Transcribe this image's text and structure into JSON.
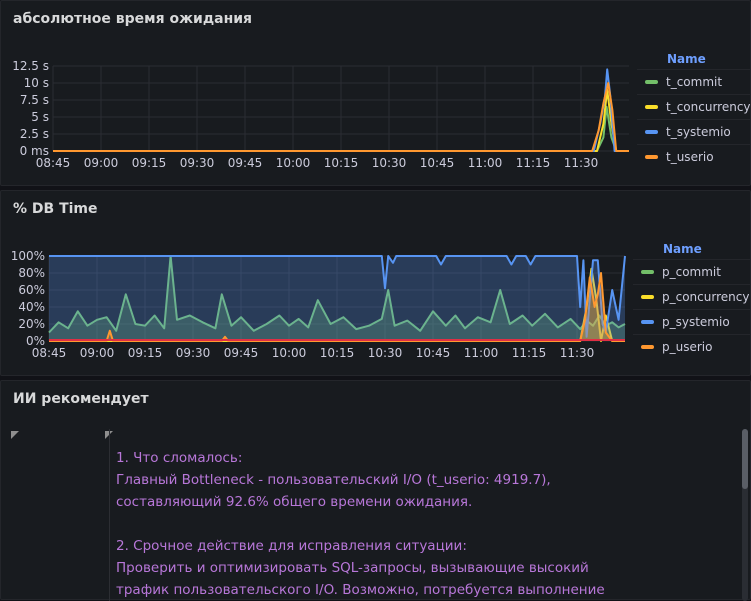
{
  "panels": {
    "wait_time": {
      "title": "абсолютное время ожидания"
    },
    "db_time": {
      "title": "% DB Time"
    },
    "ai": {
      "title": "ИИ рекомендует",
      "text": "1. Что сломалось:\nГлавный Bottleneck - пользовательский I/O (t_userio: 4919.7),\nсоставляющий 92.6% общего времени ожидания.\n\n2. Срочное действие для исправления ситуации:\nПроверить и оптимизировать SQL-запросы, вызывающие высокий\nтрафик пользовательского I/O. Возможно, потребуется выполнение"
    }
  },
  "colors": {
    "commit": "#73bf69",
    "concurrency": "#fade2a",
    "systemio": "#5794f2",
    "userio": "#ff9830",
    "userio_dark": "#e02f44",
    "bg": "#181b1f",
    "legend_header": "#6e9fff",
    "text_purple": "#b877d9"
  },
  "chart_data": [
    {
      "type": "line",
      "x_ticks": [
        "08:45",
        "09:00",
        "09:15",
        "09:30",
        "09:45",
        "10:00",
        "10:15",
        "10:30",
        "10:45",
        "11:00",
        "11:15",
        "11:30"
      ],
      "y_ticks": [
        "0 ms",
        "2.5 s",
        "5 s",
        "7.5 s",
        "10 s",
        "12.5 s"
      ],
      "ylim": [
        0,
        12.5
      ],
      "grid": true,
      "legend_title": "Name",
      "legend_position": "right",
      "series": [
        {
          "name": "t_commit",
          "color": "#73bf69",
          "points": [
            [
              0,
              0
            ],
            [
              170,
              0
            ],
            [
              172,
              2
            ],
            [
              173,
              6.5
            ],
            [
              174.5,
              2
            ],
            [
              176,
              0
            ],
            [
              180,
              0
            ]
          ]
        },
        {
          "name": "t_concurrency",
          "color": "#fade2a",
          "points": [
            [
              0,
              0
            ],
            [
              170,
              0
            ],
            [
              172,
              4
            ],
            [
              173.2,
              9
            ],
            [
              174.5,
              4
            ],
            [
              176,
              0
            ],
            [
              180,
              0
            ]
          ]
        },
        {
          "name": "t_systemio",
          "color": "#5794f2",
          "points": [
            [
              0,
              0
            ],
            [
              169,
              0
            ],
            [
              171,
              4
            ],
            [
              172.5,
              8
            ],
            [
              173.2,
              12
            ],
            [
              174.2,
              8
            ],
            [
              175.5,
              0
            ],
            [
              180,
              0
            ]
          ]
        },
        {
          "name": "t_userio",
          "color": "#ff9830",
          "points": [
            [
              0,
              0
            ],
            [
              168.5,
              0
            ],
            [
              170.5,
              3
            ],
            [
              172,
              7
            ],
            [
              173.5,
              10
            ],
            [
              174.8,
              6
            ],
            [
              176,
              0
            ],
            [
              180,
              0
            ]
          ]
        }
      ]
    },
    {
      "type": "area",
      "x_ticks": [
        "08:45",
        "09:00",
        "09:15",
        "09:30",
        "09:45",
        "10:00",
        "10:15",
        "10:30",
        "10:45",
        "11:00",
        "11:15",
        "11:30"
      ],
      "y_ticks": [
        "0%",
        "20%",
        "40%",
        "60%",
        "80%",
        "100%"
      ],
      "ylim": [
        0,
        100
      ],
      "grid": true,
      "legend_title": "Name",
      "legend_position": "right",
      "series": [
        {
          "name": "p_commit",
          "color": "#73bf69",
          "points": [
            [
              0,
              10
            ],
            [
              3,
              22
            ],
            [
              6,
              15
            ],
            [
              9,
              35
            ],
            [
              12,
              18
            ],
            [
              15,
              25
            ],
            [
              18,
              28
            ],
            [
              21,
              12
            ],
            [
              24,
              55
            ],
            [
              27,
              20
            ],
            [
              30,
              18
            ],
            [
              33,
              30
            ],
            [
              36,
              15
            ],
            [
              38,
              100
            ],
            [
              40,
              25
            ],
            [
              44,
              30
            ],
            [
              48,
              22
            ],
            [
              52,
              15
            ],
            [
              54,
              55
            ],
            [
              57,
              18
            ],
            [
              60,
              28
            ],
            [
              64,
              12
            ],
            [
              68,
              20
            ],
            [
              72,
              30
            ],
            [
              75,
              18
            ],
            [
              78,
              26
            ],
            [
              81,
              16
            ],
            [
              84,
              48
            ],
            [
              88,
              20
            ],
            [
              92,
              28
            ],
            [
              96,
              14
            ],
            [
              100,
              18
            ],
            [
              104,
              26
            ],
            [
              106,
              60
            ],
            [
              108,
              18
            ],
            [
              112,
              24
            ],
            [
              116,
              12
            ],
            [
              120,
              35
            ],
            [
              124,
              18
            ],
            [
              127,
              30
            ],
            [
              130,
              15
            ],
            [
              134,
              28
            ],
            [
              138,
              22
            ],
            [
              141,
              60
            ],
            [
              144,
              20
            ],
            [
              148,
              30
            ],
            [
              151,
              18
            ],
            [
              155,
              32
            ],
            [
              159,
              16
            ],
            [
              163,
              26
            ],
            [
              166,
              14
            ],
            [
              168,
              24
            ],
            [
              170,
              18
            ],
            [
              172,
              30
            ],
            [
              174,
              18
            ],
            [
              176,
              22
            ],
            [
              178,
              16
            ],
            [
              180,
              20
            ]
          ]
        },
        {
          "name": "p_concurrency",
          "color": "#fade2a",
          "points": [
            [
              0,
              0
            ],
            [
              166,
              0
            ],
            [
              168,
              40
            ],
            [
              169.5,
              85
            ],
            [
              171,
              50
            ],
            [
              172.5,
              0
            ],
            [
              174,
              30
            ],
            [
              176,
              0
            ],
            [
              180,
              0
            ]
          ]
        },
        {
          "name": "p_systemio",
          "color": "#5794f2",
          "points": [
            [
              0,
              100
            ],
            [
              104,
              100
            ],
            [
              105,
              62
            ],
            [
              106,
              100
            ],
            [
              107.5,
              92
            ],
            [
              108.5,
              100
            ],
            [
              121,
              100
            ],
            [
              122.5,
              90
            ],
            [
              124,
              100
            ],
            [
              143,
              100
            ],
            [
              144.5,
              90
            ],
            [
              146,
              100
            ],
            [
              149,
              100
            ],
            [
              150.5,
              90
            ],
            [
              152,
              100
            ],
            [
              165,
              100
            ],
            [
              166,
              40
            ],
            [
              167,
              95
            ],
            [
              168,
              5
            ],
            [
              170,
              95
            ],
            [
              171.5,
              95
            ],
            [
              173,
              20
            ],
            [
              174,
              10
            ],
            [
              176,
              60
            ],
            [
              178,
              25
            ],
            [
              180,
              100
            ]
          ]
        },
        {
          "name": "p_userio",
          "color": "#ff9830",
          "points": [
            [
              0,
              0
            ],
            [
              18,
              0
            ],
            [
              19,
              12
            ],
            [
              20,
              0
            ],
            [
              54,
              0
            ],
            [
              55,
              5
            ],
            [
              56,
              0
            ],
            [
              166,
              0
            ],
            [
              167.5,
              25
            ],
            [
              169,
              75
            ],
            [
              170.5,
              40
            ],
            [
              171.5,
              55
            ],
            [
              172.5,
              80
            ],
            [
              174,
              10
            ],
            [
              176,
              0
            ],
            [
              180,
              0
            ]
          ]
        }
      ]
    }
  ]
}
